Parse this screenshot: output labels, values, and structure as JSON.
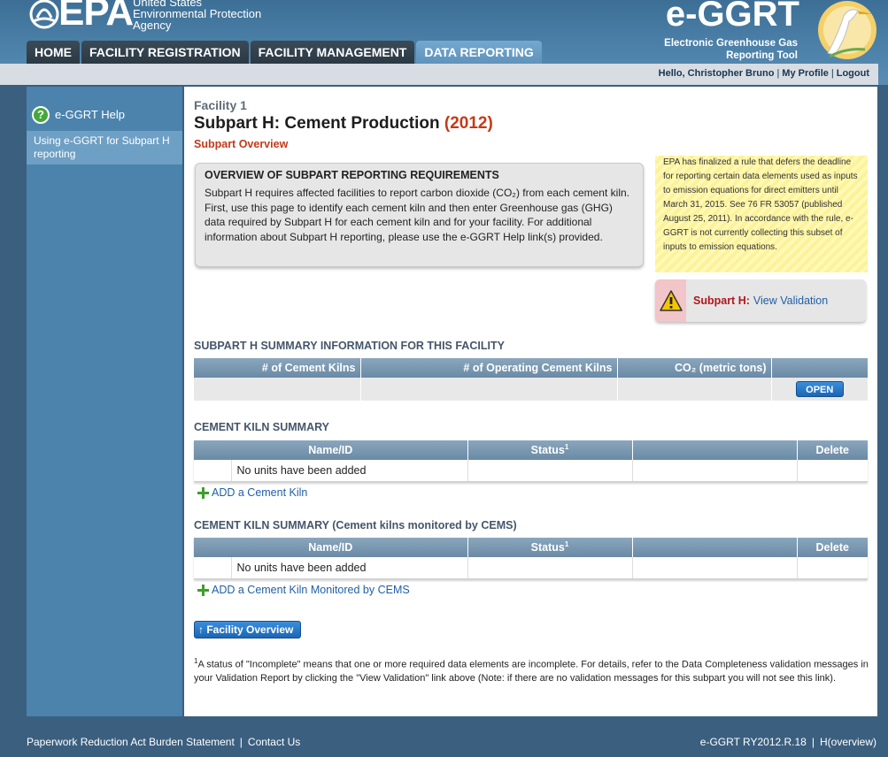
{
  "header": {
    "epa_logo_text": "EPA",
    "agency_lines": [
      "United States",
      "Environmental Protection",
      "Agency"
    ],
    "app_logo_text": "e-GGRT",
    "app_subtitle_lines": [
      "Electronic Greenhouse Gas",
      "Reporting Tool"
    ]
  },
  "nav": {
    "tabs": [
      {
        "label": "HOME",
        "active": false
      },
      {
        "label": "FACILITY REGISTRATION",
        "active": false
      },
      {
        "label": "FACILITY MANAGEMENT",
        "active": false
      },
      {
        "label": "DATA REPORTING",
        "active": true
      }
    ]
  },
  "userbar": {
    "greeting": "Hello, Christopher Bruno",
    "profile_link": "My Profile",
    "logout_link": "Logout"
  },
  "sidebar": {
    "help_label": "e-GGRT Help",
    "help_item": "Using e-GGRT for Subpart H reporting"
  },
  "page": {
    "facility": "Facility 1",
    "title": "Subpart H: Cement Production",
    "year": "(2012)",
    "subtitle": "Subpart Overview"
  },
  "overview": {
    "title": "OVERVIEW OF SUBPART REPORTING REQUIREMENTS",
    "text": "Subpart H requires affected facilities to report carbon dioxide (CO₂) from each cement kiln. First, use this page to identify each cement kiln and then enter Greenhouse gas (GHG) data required by Subpart H for each cement kiln and for your facility. For additional information about Subpart H reporting, please use the e-GGRT Help link(s) provided."
  },
  "notice": {
    "text": "EPA has finalized a rule that defers the deadline for reporting certain data elements used as inputs to emission equations for direct emitters until March 31, 2015. See 76 FR 53057 (published August 25, 2011). In accordance with the rule, e-GGRT is not currently collecting this subset of inputs to emission equations."
  },
  "validation": {
    "label": "Subpart H:",
    "link": "View Validation",
    "icon": "warning-icon"
  },
  "summary": {
    "title": "SUBPART H SUMMARY INFORMATION FOR THIS FACILITY",
    "columns": [
      "# of Cement Kilns",
      "# of Operating Cement Kilns",
      "CO₂ (metric tons)",
      ""
    ],
    "row": [
      "",
      "",
      ""
    ],
    "open_label": "OPEN"
  },
  "kiln_summary": {
    "title": "CEMENT KILN SUMMARY",
    "columns": [
      "Name/ID",
      "Status",
      "",
      "Delete"
    ],
    "status_sup": "1",
    "empty_text": "No units have been added",
    "add_label": "ADD a Cement Kiln"
  },
  "kiln_cems_summary": {
    "title": "CEMENT KILN SUMMARY (Cement kilns monitored by CEMS)",
    "columns": [
      "Name/ID",
      "Status",
      "",
      "Delete"
    ],
    "status_sup": "1",
    "empty_text": "No units have been added",
    "add_label": "ADD a Cement Kiln Monitored by CEMS"
  },
  "facility_overview_button": "Facility Overview",
  "footnote": {
    "sup": "1",
    "text": "A status of \"Incomplete\" means that one or more required data elements are incomplete. For details, refer to the Data Completeness validation messages in your Validation Report by clicking the \"View Validation\" link above (Note: if there are no validation messages for this subpart you will not see this link)."
  },
  "footer": {
    "left_links": [
      "Paperwork Reduction Act Burden Statement",
      "Contact Us"
    ],
    "version": "e-GGRT RY2012.R.18",
    "page_code": "H(overview)"
  },
  "colors": {
    "accent_red": "#c43a18",
    "link_blue": "#1f5fa6",
    "header_blue": "#4d82aa"
  }
}
